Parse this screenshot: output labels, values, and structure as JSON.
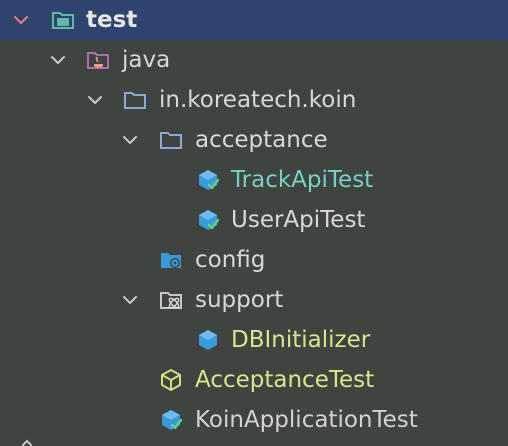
{
  "tree": {
    "rows": [
      {
        "label": "test",
        "icon": "test-root-folder-icon",
        "expanded": true,
        "selected": true
      },
      {
        "label": "java",
        "icon": "java-source-folder-icon",
        "expanded": true
      },
      {
        "label": "in.koreatech.koin",
        "icon": "package-folder-icon",
        "expanded": true
      },
      {
        "label": "acceptance",
        "icon": "package-folder-icon",
        "expanded": true
      },
      {
        "label": "TrackApiTest",
        "icon": "test-class-icon"
      },
      {
        "label": "UserApiTest",
        "icon": "test-class-icon"
      },
      {
        "label": "config",
        "icon": "config-folder-icon",
        "expanded": false
      },
      {
        "label": "support",
        "icon": "support-folder-icon",
        "expanded": true
      },
      {
        "label": "DBInitializer",
        "icon": "class-icon"
      },
      {
        "label": "AcceptanceTest",
        "icon": "abstract-class-icon"
      },
      {
        "label": "KoinApplicationTest",
        "icon": "test-class-icon"
      }
    ]
  },
  "colors": {
    "background": "#3f4440",
    "selection": "#2e436e",
    "test_folder": "#5fb8a8",
    "package_folder": "#8fa6d6",
    "class_icon": "#3a9ad9",
    "abstract_icon": "#cde37a",
    "teal_text": "#79cfc4",
    "green_text": "#d3e88c"
  }
}
